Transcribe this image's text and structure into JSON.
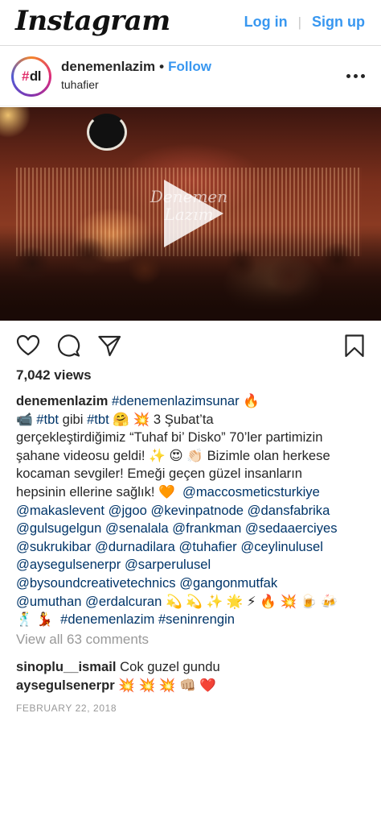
{
  "header": {
    "logo_text": "Instagram",
    "login_label": "Log in",
    "separator": "|",
    "signup_label": "Sign up"
  },
  "post": {
    "avatar_hash": "#",
    "avatar_letters": "dl",
    "username": "denemenlazim",
    "dot": "•",
    "follow_label": "Follow",
    "location": "tuhafier",
    "more_icon": "ellipsis-icon",
    "video_watermark_line1": "Denemen",
    "video_watermark_line2": "Lazım",
    "views": "7,042 views",
    "caption": {
      "username": "denemenlazim",
      "line1_tag": "#denemenlazimsunar",
      "line1_emoji": "🔥",
      "line2_emoji": "📹",
      "line2_tag1": "#tbt",
      "line2_text": "gibi",
      "line2_tag2": "#tbt",
      "line2_rest": "🤗 💥  3 Şubat’ta",
      "line3": "gerçekleştirdiğimiz “Tuhaf bi’ Disko” 70’ler partimizin",
      "line4": "şahane videosu geldi! ✨ 😍 👏🏻  Bizimle olan herkese",
      "line5": "kocaman sevgiler! Emeği geçen güzel insanların",
      "line6_text": "hepsinin ellerine sağlık! 🧡",
      "mentions": [
        "@maccosmeticsturkiye",
        "@makaslevent",
        "@jgoo",
        "@kevinpatnode",
        "@dansfabrika",
        "@gulsugelgun",
        "@senalala",
        "@frankman",
        "@sedaaerciyes",
        "@sukrukibar",
        "@durnadilara",
        "@tuhafier",
        "@ceylinulusel",
        "@aysegulsenerpr",
        "@sarperulusel",
        "@bysoundcreativetechnics",
        "@gangonmutfak",
        "@umuthan",
        "@erdalcuran"
      ],
      "emoji_tail": "💫 💫 ✨ 🌟 ⚡ 🔥 💥 🍺 🍻",
      "last_emoji": "🕺 💃",
      "end_tag1": "#denemenlazim",
      "end_tag2": "#seninrengin"
    },
    "view_all_comments": "View all 63 comments",
    "comments": [
      {
        "user": "sinoplu__ismail",
        "text": "Cok guzel gundu"
      },
      {
        "user": "aysegulsenerpr",
        "text": "💥 💥 💥 👊🏼 ❤️"
      }
    ],
    "date": "FEBRUARY 22, 2018"
  }
}
